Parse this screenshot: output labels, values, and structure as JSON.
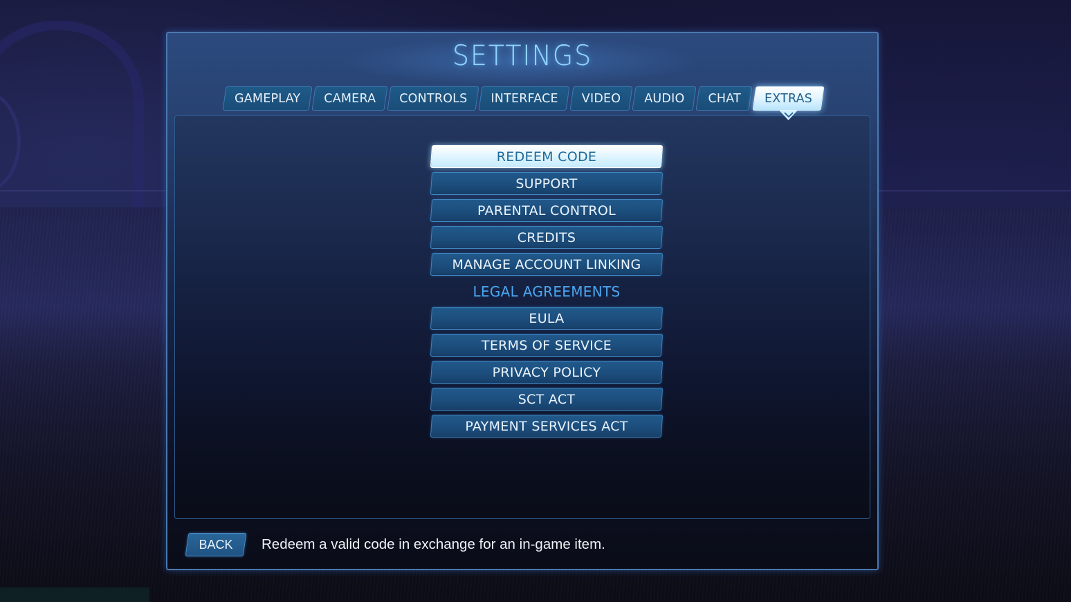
{
  "window": {
    "title": "SETTINGS"
  },
  "tabs": [
    {
      "label": "GAMEPLAY",
      "active": false
    },
    {
      "label": "CAMERA",
      "active": false
    },
    {
      "label": "CONTROLS",
      "active": false
    },
    {
      "label": "INTERFACE",
      "active": false
    },
    {
      "label": "VIDEO",
      "active": false
    },
    {
      "label": "AUDIO",
      "active": false
    },
    {
      "label": "CHAT",
      "active": false
    },
    {
      "label": "EXTRAS",
      "active": true
    }
  ],
  "extras": {
    "items": [
      {
        "label": "REDEEM CODE",
        "selected": true
      },
      {
        "label": "SUPPORT",
        "selected": false
      },
      {
        "label": "PARENTAL CONTROL",
        "selected": false
      },
      {
        "label": "CREDITS",
        "selected": false
      },
      {
        "label": "MANAGE ACCOUNT LINKING",
        "selected": false
      }
    ],
    "legal_section_label": "LEGAL AGREEMENTS",
    "legal_items": [
      {
        "label": "EULA"
      },
      {
        "label": "TERMS OF SERVICE"
      },
      {
        "label": "PRIVACY POLICY"
      },
      {
        "label": "SCT ACT"
      },
      {
        "label": "PAYMENT SERVICES ACT"
      }
    ]
  },
  "footer": {
    "back_label": "BACK",
    "hint": "Redeem a valid code in exchange for an in-game item."
  },
  "colors": {
    "accent": "#4aa6f0",
    "title": "#8fd3ff",
    "button_bg": "#1c4e7d",
    "selected_bg": "#e3f6ff",
    "selected_text": "#1f6a99"
  }
}
